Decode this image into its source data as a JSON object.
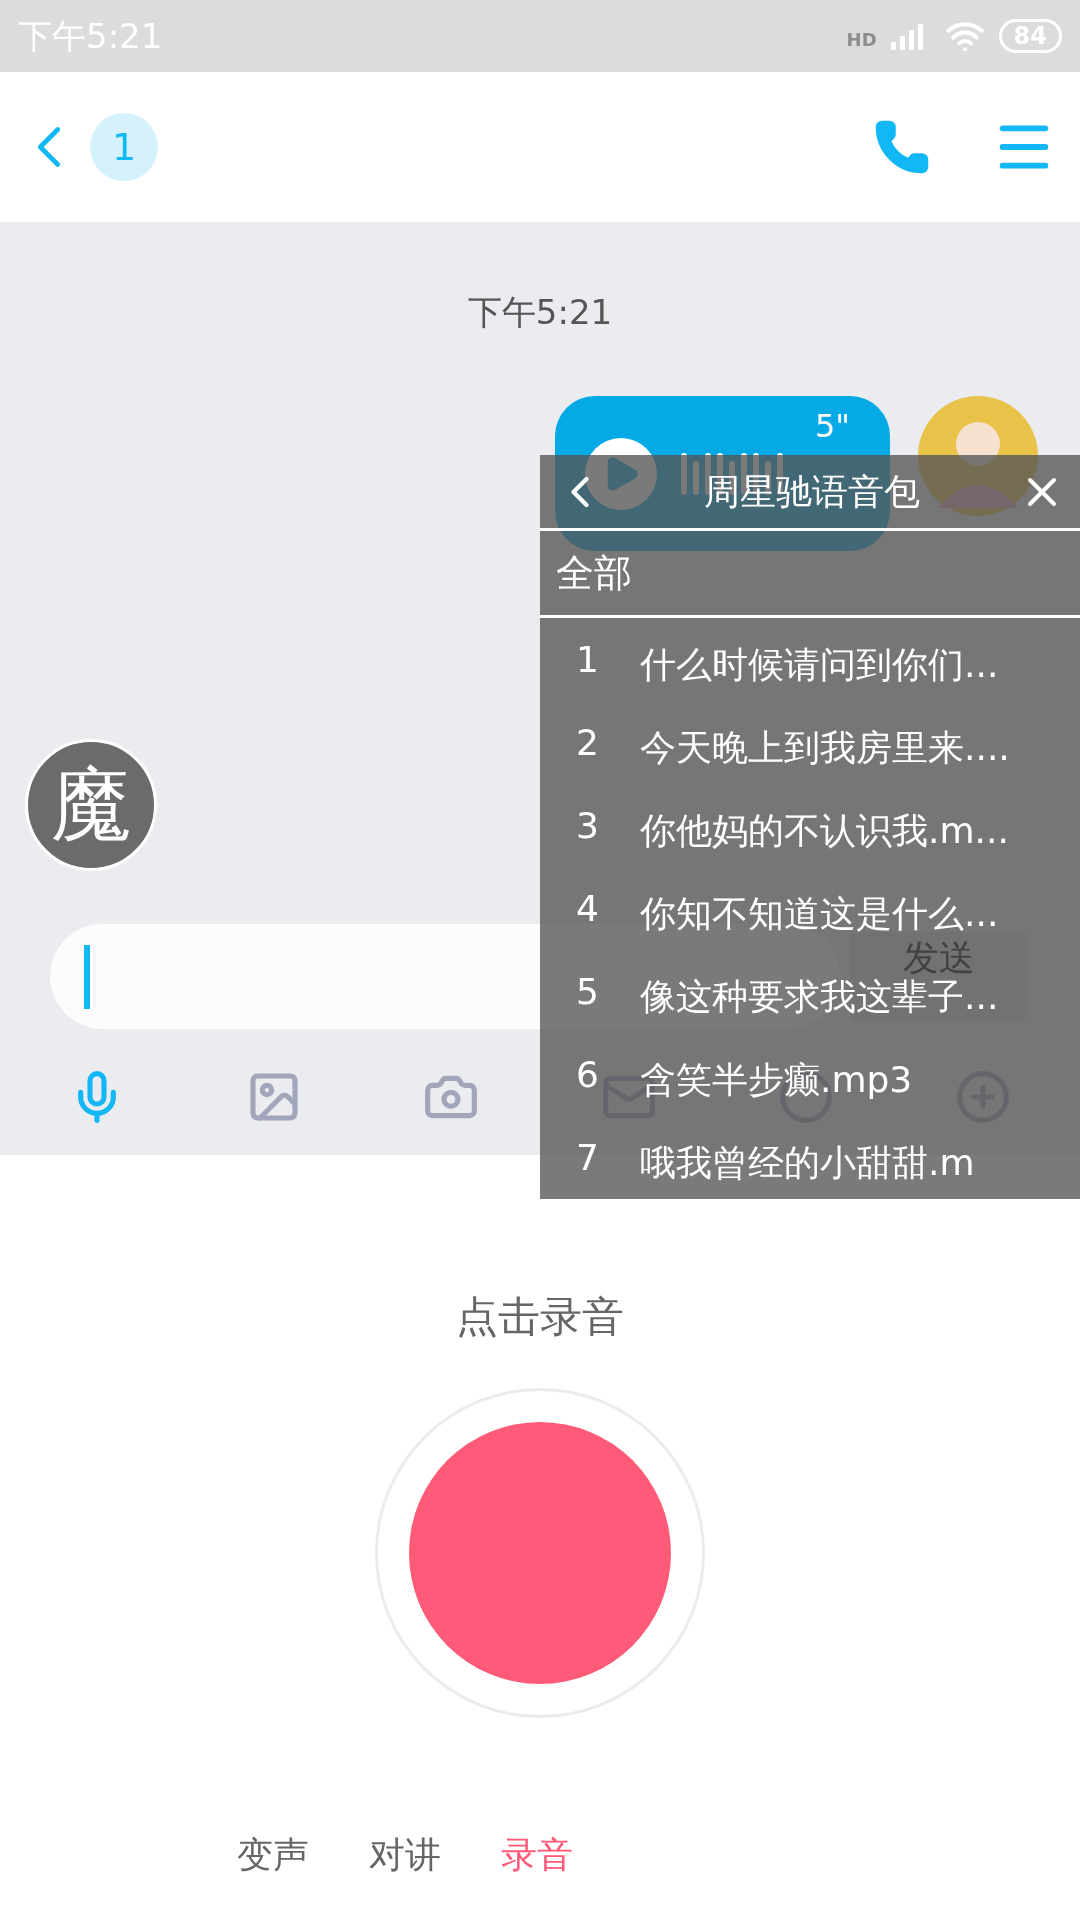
{
  "status_bar": {
    "time": "下午5:21",
    "network": "HD",
    "battery": "84"
  },
  "header": {
    "unread": "1"
  },
  "chat": {
    "timestamp": "下午5:21",
    "messages": [
      {
        "kind": "voice",
        "duration": "5\""
      }
    ]
  },
  "sender_avatar": {
    "text": "魔"
  },
  "input": {
    "send": "发送"
  },
  "toolbar": [
    {
      "kind": "mic",
      "selected": true
    },
    {
      "kind": "image",
      "selected": false
    },
    {
      "kind": "camera",
      "selected": false
    },
    {
      "kind": "mail",
      "selected": false
    },
    {
      "kind": "circle",
      "selected": false
    },
    {
      "kind": "plus",
      "selected": false
    }
  ],
  "voice_pack": {
    "title": "周星驰语音包",
    "category": "全部",
    "items": [
      {
        "number": "1",
        "name": "什么时候请问到你们..."
      },
      {
        "number": "2",
        "name": "今天晚上到我房里来...."
      },
      {
        "number": "3",
        "name": "你他妈的不认识我.m..."
      },
      {
        "number": "4",
        "name": "你知不知道这是什么..."
      },
      {
        "number": "5",
        "name": "像这种要求我这辈子..."
      },
      {
        "number": "6",
        "name": "含笑半步癫.mp3"
      },
      {
        "number": "7",
        "name": "哦我曾经的小甜甜.m"
      }
    ]
  },
  "record": {
    "prompt": "点击录音"
  },
  "modes": [
    {
      "label": "变声",
      "selected": false
    },
    {
      "label": "对讲",
      "selected": false
    },
    {
      "label": "录音",
      "selected": true
    }
  ]
}
